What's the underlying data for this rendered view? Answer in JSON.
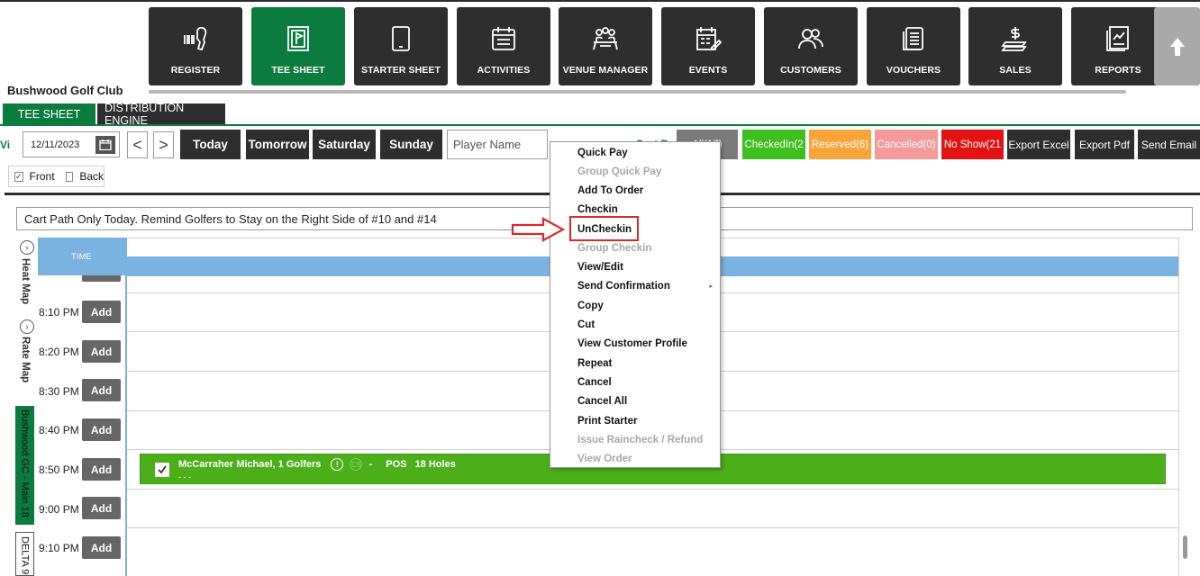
{
  "club_name": "Bushwood Golf Club",
  "nav": [
    {
      "label": "REGISTER",
      "icon": "scanner-icon"
    },
    {
      "label": "TEE SHEET",
      "icon": "flag-board-icon",
      "active": true
    },
    {
      "label": "STARTER SHEET",
      "icon": "tablet-icon"
    },
    {
      "label": "ACTIVITIES",
      "icon": "checklist-icon"
    },
    {
      "label": "VENUE MANAGER",
      "icon": "meeting-icon"
    },
    {
      "label": "EVENTS",
      "icon": "calendar-edit-icon"
    },
    {
      "label": "CUSTOMERS",
      "icon": "people-icon"
    },
    {
      "label": "VOUCHERS",
      "icon": "voucher-icon"
    },
    {
      "label": "SALES",
      "icon": "money-icon"
    },
    {
      "label": "REPORTS",
      "icon": "report-icon"
    }
  ],
  "tabs": {
    "tee_sheet": "TEE SHEET",
    "distribution_engine": "DISTRIBUTION ENGINE"
  },
  "toolbar": {
    "view_label": "Vi",
    "date": "12/11/2023",
    "prev": "<",
    "next": ">",
    "today": "Today",
    "tomorrow": "Tomorrow",
    "saturday": "Saturday",
    "sunday": "Sunday",
    "player_placeholder": "Player Name",
    "sort_by": "Sort By",
    "all_label": "All(17)",
    "checked_in": "CheckedIn(2",
    "reserved": "Reserved(6)",
    "cancelled": "Cancelled(0)",
    "no_show": "No Show(21",
    "export_excel": "Export Excel",
    "export_pdf": "Export Pdf",
    "send_email": "Send Email"
  },
  "nines": {
    "front": "Front",
    "back": "Back",
    "front_checked": true,
    "back_checked": false
  },
  "notice": "Cart Path Only Today.   Remind Golfers to Stay on the Right Side of #10 and #14",
  "side_tabs": {
    "heat_map": "Heat Map",
    "rate_map": "Rate Map",
    "course": "Bushwood GC - Main 18",
    "delta": "DELTA 9"
  },
  "grid": {
    "time_header": "TIME",
    "add_label": "Add",
    "times": [
      "8:10 PM",
      "8:20 PM",
      "8:30 PM",
      "8:40 PM",
      "8:50 PM",
      "9:00 PM",
      "9:10 PM"
    ]
  },
  "booking": {
    "text": "McCarraher Michael, 1 Golfers",
    "dash": "-",
    "pos": "POS",
    "holes": "18 Holes",
    "sub": "- - -",
    "excl": "!",
    "cart": "CS"
  },
  "context_menu": [
    {
      "label": "Quick Pay",
      "enabled": true
    },
    {
      "label": "Group Quick Pay",
      "enabled": false
    },
    {
      "label": "Add To Order",
      "enabled": true
    },
    {
      "label": "Checkin",
      "enabled": true
    },
    {
      "label": "UnCheckin",
      "enabled": true,
      "highlighted": true
    },
    {
      "label": "Group Checkin",
      "enabled": false
    },
    {
      "label": "View/Edit",
      "enabled": true
    },
    {
      "label": "Send Confirmation",
      "enabled": true,
      "submenu": true
    },
    {
      "label": "Copy",
      "enabled": true
    },
    {
      "label": "Cut",
      "enabled": true
    },
    {
      "label": "View Customer Profile",
      "enabled": true
    },
    {
      "label": "Repeat",
      "enabled": true
    },
    {
      "label": "Cancel",
      "enabled": true
    },
    {
      "label": "Cancel All",
      "enabled": true
    },
    {
      "label": "Print Starter",
      "enabled": true
    },
    {
      "label": "Issue Raincheck / Refund",
      "enabled": false
    },
    {
      "label": "View Order",
      "enabled": false
    }
  ],
  "colors": {
    "green": "#0c7b3e",
    "dark": "#2e2e2e",
    "booking_green": "#4caf1a",
    "checkedin": "#3fbf1f",
    "reserved": "#f7a43a",
    "cancelled": "#f59a9a",
    "noshow": "#e31212",
    "grid_blue": "#7ab3e0",
    "highlight_red": "#d92a2a"
  }
}
